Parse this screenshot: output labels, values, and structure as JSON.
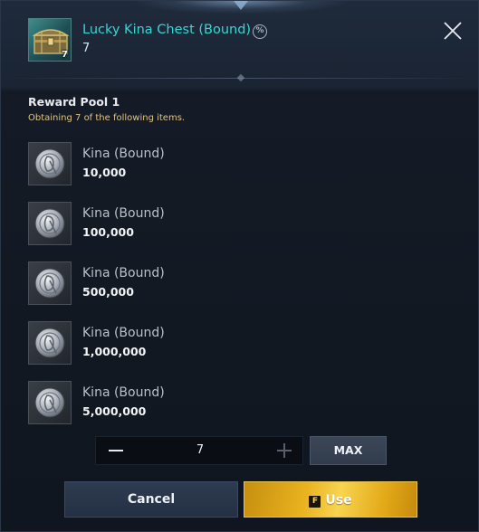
{
  "item": {
    "title": "Lucky Kina Chest (Bound)",
    "count": "7",
    "icon_count": "7",
    "bound_badge": "%"
  },
  "pool": {
    "title": "Reward Pool 1",
    "description": "Obtaining 7 of the following items."
  },
  "rewards": [
    {
      "name": "Kina (Bound)",
      "amount": "10,000"
    },
    {
      "name": "Kina (Bound)",
      "amount": "100,000"
    },
    {
      "name": "Kina (Bound)",
      "amount": "500,000"
    },
    {
      "name": "Kina (Bound)",
      "amount": "1,000,000"
    },
    {
      "name": "Kina (Bound)",
      "amount": "5,000,000"
    }
  ],
  "quantity": {
    "value": "7",
    "max_label": "MAX"
  },
  "actions": {
    "cancel_label": "Cancel",
    "use_key": "F",
    "use_label": "Use"
  },
  "colors": {
    "title_accent": "#35d7d3",
    "description_gold": "#e0c48a",
    "use_button_gold": "#e9b21e"
  },
  "icons": {
    "chest": "treasure-chest-icon",
    "coin": "kina-coin-icon",
    "close": "close-icon",
    "bound": "bound-icon"
  }
}
